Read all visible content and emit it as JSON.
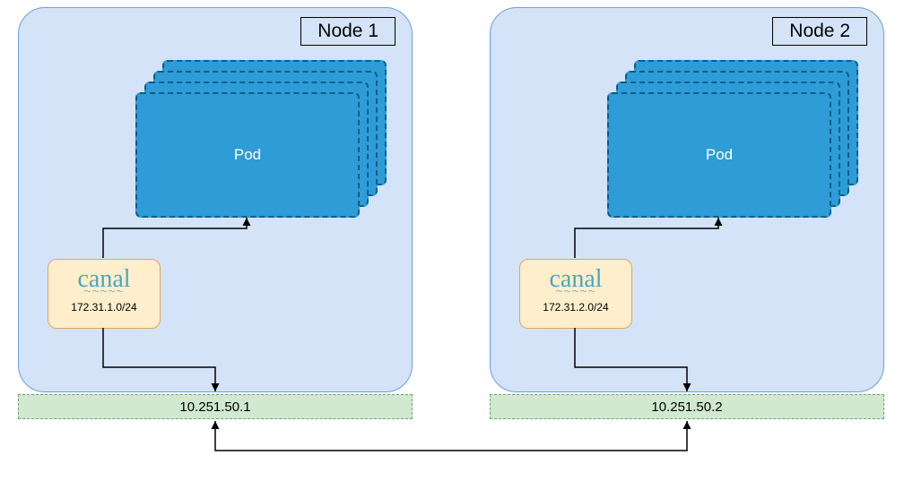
{
  "nodes": [
    {
      "label": "Node 1",
      "pod_label": "Pod",
      "canal_logo": "canal",
      "canal_subnet": "172.31.1.0/24",
      "ip": "10.251.50.1"
    },
    {
      "label": "Node 2",
      "pod_label": "Pod",
      "canal_logo": "canal",
      "canal_subnet": "172.31.2.0/24",
      "ip": "10.251.50.2"
    }
  ],
  "colors": {
    "node_bg": "#d4e3f7",
    "node_border": "#6d9de6",
    "pod_bg": "#2e9cd6",
    "pod_border": "#0a5d8a",
    "canal_bg": "#ffeecc",
    "canal_border": "#d4a95e",
    "ip_bg": "#d1e8d1",
    "ip_border": "#6ca66c"
  }
}
